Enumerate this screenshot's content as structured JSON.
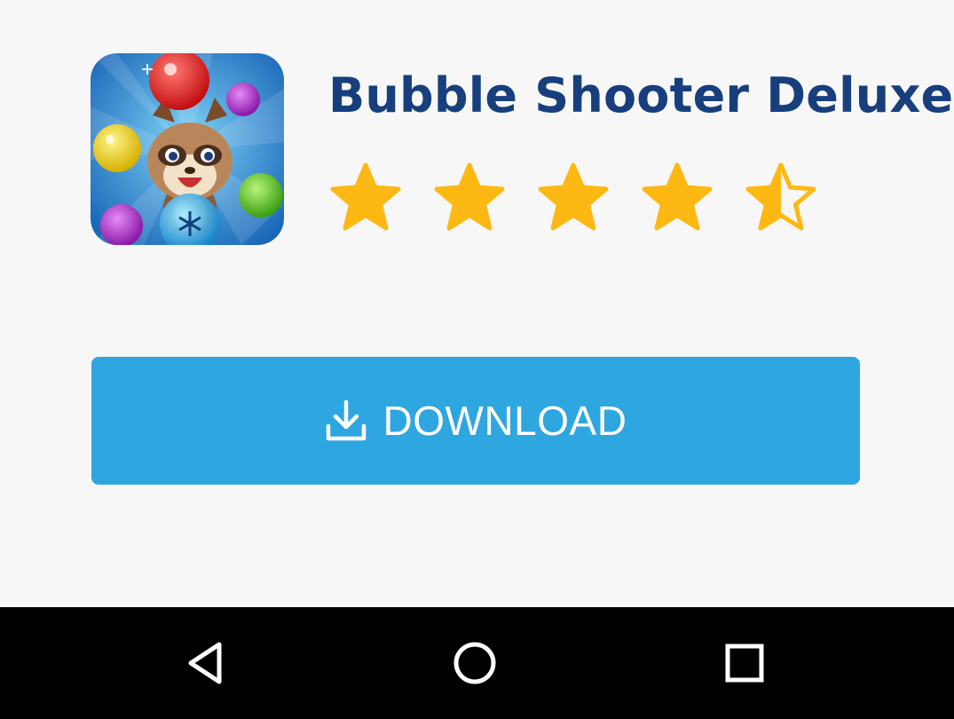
{
  "app": {
    "title": "Bubble Shooter Deluxe",
    "icon": "bubble-shooter-app-icon",
    "rating": 4.5,
    "rating_max": 5
  },
  "download": {
    "label": "DOWNLOAD",
    "icon": "download-icon",
    "color": "#2ea6e0"
  },
  "nav": {
    "back_icon": "back-triangle-icon",
    "home_icon": "home-circle-icon",
    "recents_icon": "recents-square-icon"
  },
  "colors": {
    "title": "#173f7d",
    "star": "#fdb813",
    "background": "#f7f7f7",
    "nav_bar": "#000000"
  }
}
